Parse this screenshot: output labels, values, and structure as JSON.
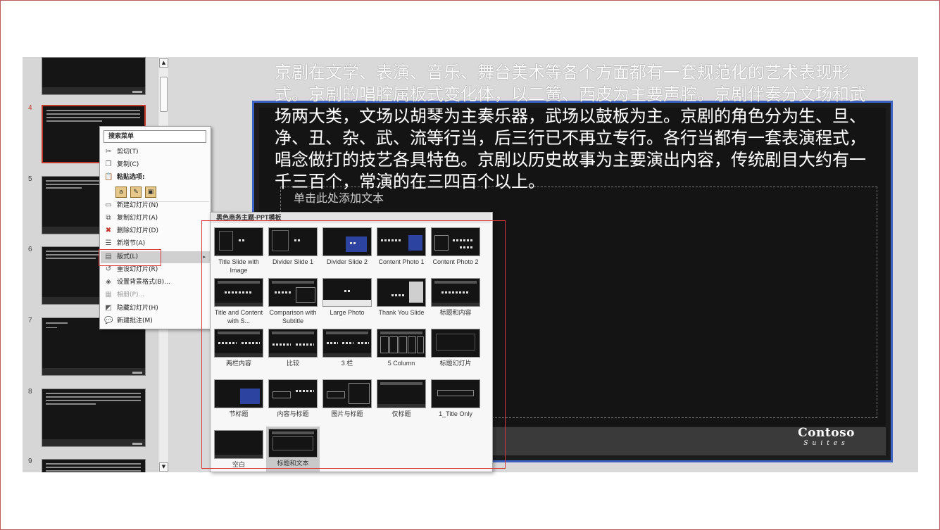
{
  "overlay_paragraph": "京剧在文学、表演、音乐、舞台美术等各个方面都有一套规范化的艺术表现形式。京剧的唱腔属板式变化体，以二簧、西皮为主要声腔。京剧伴奏分文场和武场两大类，文场以胡琴为主奏乐器，武场以鼓板为主。京剧的角色分为生、旦、净、丑、杂、武、流等行当，后三行已不再立专行。各行当都有一套表演程式，唱念做打的技艺各具特色。京剧以历史故事为主要演出内容，传统剧目大约有一千三百个，常演的在三四百个以上。",
  "slide": {
    "placeholder_text": "单击此处添加文本",
    "logo_main": "Contoso",
    "logo_sub": "Suites"
  },
  "thumbnails": {
    "numbers": [
      "4",
      "5",
      "6",
      "7",
      "8",
      "9"
    ],
    "selected_index": 4
  },
  "scrollbar": {
    "up": "▲",
    "down": "▼"
  },
  "context_menu": {
    "search": "搜索菜单",
    "items": {
      "cut": "剪切(T)",
      "copy": "复制(C)",
      "paste_options": "粘贴选项:",
      "new_slide": "新建幻灯片(N)",
      "duplicate_slide": "复制幻灯片(A)",
      "delete_slide": "删除幻灯片(D)",
      "new_section": "新增节(A)",
      "layout": "版式(L)",
      "reset_slide": "重设幻灯片(R)",
      "format_background": "设置背景格式(B)...",
      "photo_album": "相册(P)...",
      "hide_slide": "隐藏幻灯片(H)",
      "new_comment": "新建批注(M)"
    },
    "submenu_arrow": "▸"
  },
  "layout_gallery": {
    "header": "黑色商务主题-PPT模板",
    "layouts": [
      "Title Slide with Image",
      "Divider Slide 1",
      "Divider Slide 2",
      "Content Photo 1",
      "Content Photo 2",
      "Title and Content with S...",
      "Comparison with Subtitle",
      "Large Photo",
      "Thank You Slide",
      "标题和内容",
      "两栏内容",
      "比较",
      "3 栏",
      "5 Column",
      "标题幻灯片",
      "节标题",
      "内容与标题",
      "图片与标题",
      "仅标题",
      "1_Title Only",
      "空白",
      "标题和文本"
    ],
    "selected": "标题和文本"
  },
  "colors": {
    "highlight_red": "#d83a3a",
    "slide_border_blue": "#3c62c4",
    "accent_blue": "#2c44a0"
  }
}
